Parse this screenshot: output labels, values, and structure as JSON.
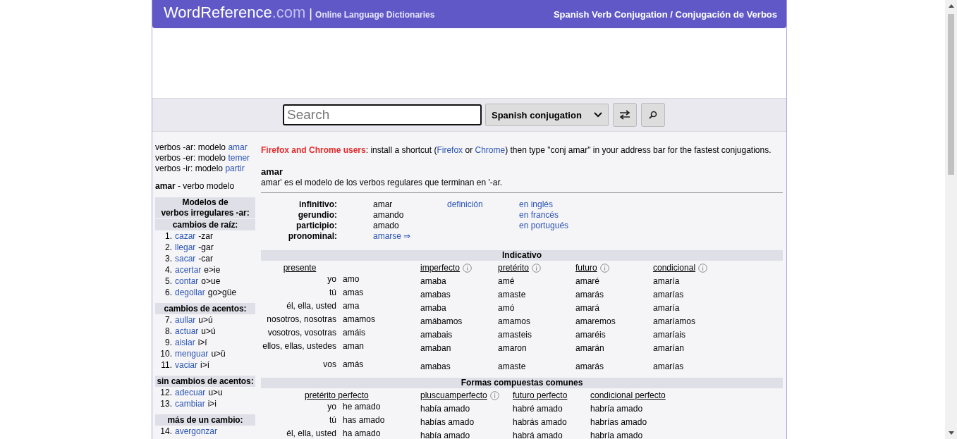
{
  "header": {
    "logo": "WordReference",
    "logo_suffix": ".com",
    "separator": "|",
    "tagline": "Online Language Dictionaries",
    "title": "Spanish Verb Conjugation / Conjugación de Verbos"
  },
  "search": {
    "placeholder": "Search",
    "select": "Spanish conjugation"
  },
  "sidebar": {
    "models": [
      {
        "prefix": "verbos -ar: modelo",
        "verb": "amar"
      },
      {
        "prefix": "verbos -er: modelo",
        "verb": "temer"
      },
      {
        "prefix": "verbos -ir: modelo",
        "verb": "partir"
      }
    ],
    "current": {
      "verb": "amar",
      "text": "- verbo modelo"
    },
    "heading_lines": [
      "Modelos de",
      "verbos irregulares -ar:"
    ],
    "groups": [
      {
        "heading": "cambios de raíz:",
        "items": [
          {
            "number": "1.",
            "verb": "cazar",
            "change": "-zar"
          },
          {
            "number": "2.",
            "verb": "llegar",
            "change": "-gar"
          },
          {
            "number": "3.",
            "verb": "sacar",
            "change": "-car"
          },
          {
            "number": "4.",
            "verb": "acertar",
            "change": "e>ie"
          },
          {
            "number": "5.",
            "verb": "contar",
            "change": "o>ue"
          },
          {
            "number": "6.",
            "verb": "degollar",
            "change": "go>güe"
          }
        ]
      },
      {
        "heading": "cambios de acentos:",
        "items": [
          {
            "number": "7.",
            "verb": "aullar",
            "change": "u>ú"
          },
          {
            "number": "8.",
            "verb": "actuar",
            "change": "u>ú"
          },
          {
            "number": "9.",
            "verb": "aislar",
            "change": "i>í"
          },
          {
            "number": "10.",
            "verb": "menguar",
            "change": "u>ü"
          },
          {
            "number": "11.",
            "verb": "vaciar",
            "change": "i>í"
          }
        ]
      },
      {
        "heading": "sin cambios de acentos:",
        "items": [
          {
            "number": "12.",
            "verb": "adecuar",
            "change": "u>u"
          },
          {
            "number": "13.",
            "verb": "cambiar",
            "change": "i>i"
          }
        ]
      },
      {
        "heading": "más de un cambio:",
        "items": [
          {
            "number": "14.",
            "verb": "avergonzar"
          }
        ]
      }
    ]
  },
  "notice": {
    "highlight": "Firefox and Chrome users",
    "text_1": ": install a shortcut (",
    "link_1": "Firefox",
    "text_2": " or ",
    "link_2": "Chrome",
    "text_3": ") then type \"conj amar\" in your address bar for the fastest conjugations."
  },
  "verb": {
    "title": "amar",
    "description": "amar' es el modelo de los verbos regulares que terminan en '-ar."
  },
  "forms": [
    {
      "label": "infinitivo:",
      "value": "amar",
      "kind": "text"
    },
    {
      "label": "gerundio:",
      "value": "amando",
      "kind": "text"
    },
    {
      "label": "participio:",
      "value": "amado",
      "kind": "text"
    },
    {
      "label": "pronominal:",
      "value": "amarse ⇒",
      "kind": "link"
    }
  ],
  "definition_link": "definición",
  "language_links": [
    "en inglés",
    "en francés",
    "en portugués"
  ],
  "tables": [
    {
      "title": "Indicativo",
      "kind": "simple",
      "tenses": [
        {
          "name": "presente",
          "info": false
        },
        {
          "name": "imperfecto",
          "info": true
        },
        {
          "name": "pretérito",
          "info": true
        },
        {
          "name": "futuro",
          "info": true
        },
        {
          "name": "condicional",
          "info": true
        }
      ],
      "rows": [
        {
          "kind": "main",
          "pronoun": "yo",
          "forms": [
            "amo",
            "amaba",
            "amé",
            "amaré",
            "amaría"
          ]
        },
        {
          "kind": "main",
          "pronoun": "tú",
          "forms": [
            "amas",
            "amabas",
            "amaste",
            "amarás",
            "amarías"
          ]
        },
        {
          "kind": "main",
          "pronoun": "él, ella, usted",
          "forms": [
            "ama",
            "amaba",
            "amó",
            "amará",
            "amaría"
          ]
        },
        {
          "kind": "main",
          "pronoun": "nosotros, nosotras",
          "forms": [
            "amamos",
            "amábamos",
            "amamos",
            "amaremos",
            "amaríamos"
          ]
        },
        {
          "kind": "main",
          "pronoun": "vosotros, vosotras",
          "forms": [
            "amáis",
            "amabais",
            "amasteis",
            "amaréis",
            "amaríais"
          ]
        },
        {
          "kind": "main",
          "pronoun": "ellos, ellas, ustedes",
          "forms": [
            "aman",
            "amaban",
            "amaron",
            "amarán",
            "amarían"
          ]
        },
        {
          "kind": "vos",
          "pronoun": "vos",
          "forms": [
            "amás",
            "amabas",
            "amaste",
            "amarás",
            "amarías"
          ]
        }
      ]
    },
    {
      "title": "Formas compuestas comunes",
      "kind": "compound",
      "tenses": [
        {
          "name": "pretérito perfecto",
          "info": false
        },
        {
          "name": "pluscuamperfecto",
          "info": true
        },
        {
          "name": "futuro perfecto",
          "info": false
        },
        {
          "name": "condicional perfecto",
          "info": false
        }
      ],
      "rows": [
        {
          "kind": "main",
          "pronoun": "yo",
          "forms": [
            "he amado",
            "había amado",
            "habré amado",
            "habría amado"
          ]
        },
        {
          "kind": "main",
          "pronoun": "tú",
          "forms": [
            "has amado",
            "habías amado",
            "habrás amado",
            "habrías amado"
          ]
        },
        {
          "kind": "main",
          "pronoun": "él, ella, usted",
          "forms": [
            "ha amado",
            "había amado",
            "habrá amado",
            "habría amado"
          ]
        }
      ]
    }
  ]
}
